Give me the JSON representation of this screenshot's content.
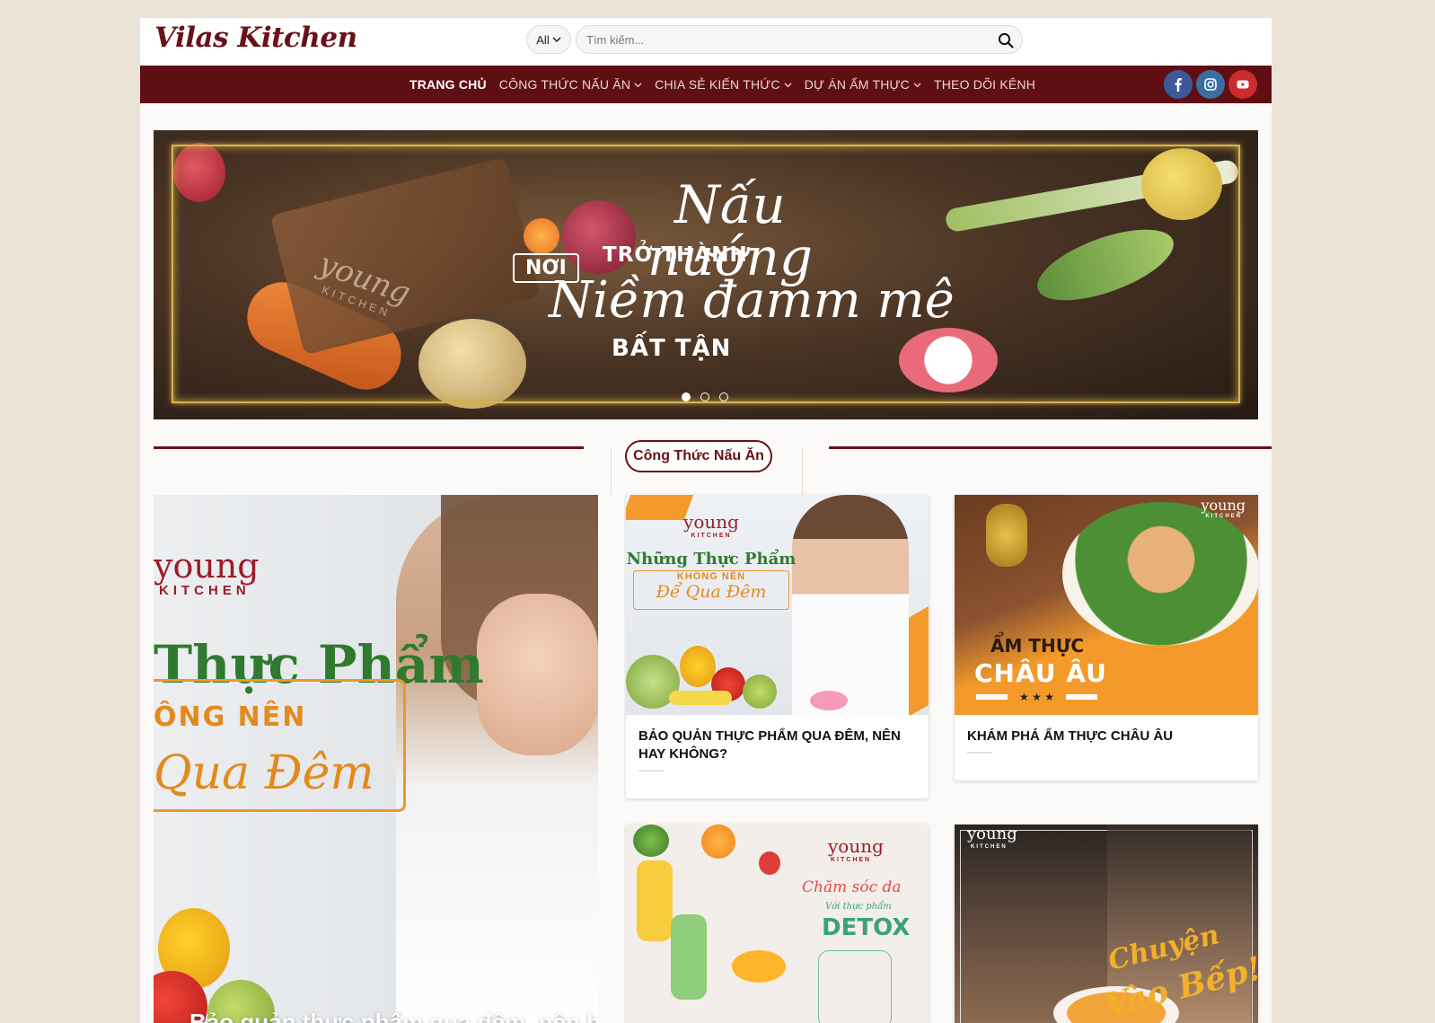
{
  "header": {
    "logo": "Vilas Kitchen",
    "search": {
      "category": "All",
      "placeholder": "Tìm kiếm..."
    }
  },
  "nav": {
    "items": [
      {
        "label": "TRANG CHỦ",
        "dropdown": false,
        "active": true
      },
      {
        "label": "CÔNG THỨC NẤU ĂN",
        "dropdown": true
      },
      {
        "label": "CHIA SẺ KIẾN THỨC",
        "dropdown": true
      },
      {
        "label": "DỰ ÁN ẨM THỰC",
        "dropdown": true
      },
      {
        "label": "THEO DÕI KÊNH",
        "dropdown": false
      }
    ],
    "socials": [
      "facebook-icon",
      "instagram-icon",
      "youtube-icon"
    ]
  },
  "hero": {
    "line1_small": "NƠI",
    "line1_script": "Nấu nướng",
    "line2": "TRỞ THÀNH",
    "line3_script": "Niềm đamm mê",
    "line4": "BẤT TẬN",
    "brand": "young",
    "brand_sub": "KITCHEN",
    "slides": 3,
    "active_slide": 1
  },
  "section": {
    "title": "Công Thức Nấu Ăn"
  },
  "feature": {
    "brand": "young",
    "brand_sub": "KITCHEN",
    "line1": "Thực Phẩm",
    "line2": "ÔNG NÊN",
    "line3": "Qua Đêm",
    "caption": "Bảo quản thực phẩm qua đêm, nên hay"
  },
  "cards": [
    {
      "title": "BẢO QUẢN THỰC PHẨM QUA ĐÊM, NÊN HAY KHÔNG?",
      "img_brand": "young",
      "img_brand_sub": "KITCHEN",
      "img_line1": "Những Thực Phẩm",
      "img_line2": "KHÔNG NÊN",
      "img_line3": "Để Qua Đêm"
    },
    {
      "title": "KHÁM PHÁ ẨM THỰC CHÂU ÂU",
      "img_brand": "young",
      "img_brand_sub": "KITCHEN",
      "img_line1": "ẨM THỰC",
      "img_line2": "CHÂU ÂU"
    },
    {
      "title": "",
      "img_brand": "young",
      "img_brand_sub": "KITCHEN",
      "img_line1": "Chăm sóc da",
      "img_line2": "Với thực phẩm",
      "img_line3": "DETOX"
    },
    {
      "title": "",
      "img_brand": "young",
      "img_brand_sub": "KITCHEN",
      "img_line1": "Chuyện",
      "img_line2": "Vào Bếp!"
    }
  ],
  "colors": {
    "brand": "#6a1018",
    "nav_bg": "#5f0f14",
    "page_bg": "#ebe3d8",
    "accent_orange": "#f39a2b"
  }
}
